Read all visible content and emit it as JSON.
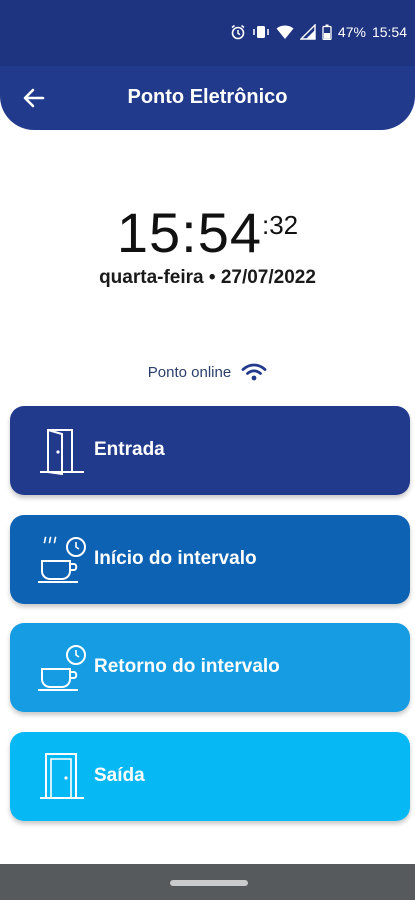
{
  "status_bar": {
    "battery": "47%",
    "time": "15:54",
    "icons": [
      "alarm-icon",
      "vibrate-icon",
      "wifi-icon",
      "signal-icon",
      "battery-icon"
    ]
  },
  "app_bar": {
    "title": "Ponto Eletrônico",
    "back_icon": "arrow-left-icon"
  },
  "clock": {
    "hours_minutes": "15:54",
    "seconds": ":32",
    "date": "quarta-feira • 27/07/2022"
  },
  "connection": {
    "label": "Ponto online",
    "icon": "wifi-icon"
  },
  "buttons": [
    {
      "label": "Entrada",
      "icon": "door-open-icon",
      "color": "#223a8c"
    },
    {
      "label": "Início do intervalo",
      "icon": "coffee-clock-icon",
      "color": "#0d62b4"
    },
    {
      "label": "Retorno do intervalo",
      "icon": "coffee-clock-icon",
      "color": "#159ce3"
    },
    {
      "label": "Saída",
      "icon": "door-exit-icon",
      "color": "#06b8f4"
    }
  ]
}
